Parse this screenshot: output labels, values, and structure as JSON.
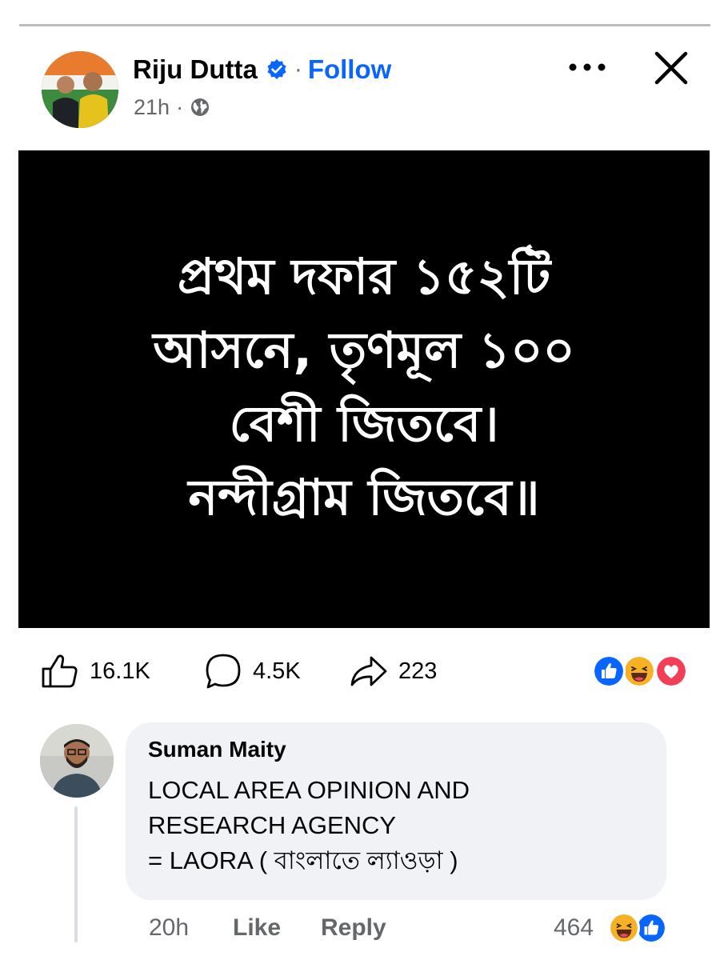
{
  "post": {
    "author": "Riju Dutta",
    "follow_label": "Follow",
    "time": "21h",
    "image_lines": [
      "প্রথম দফার ১৫২টি",
      "আসনে, তৃণমূল ১০০",
      "বেশী জিতবে।",
      "নন্দীগ্রাম জিতবে॥"
    ]
  },
  "actions": {
    "likes": "16.1K",
    "comments": "4.5K",
    "shares": "223"
  },
  "reactions": [
    "like-icon",
    "haha-icon",
    "love-icon"
  ],
  "comment": {
    "author": "Suman Maity",
    "lines": [
      "LOCAL AREA OPINION AND",
      "RESEARCH AGENCY",
      "= LAORA ( বাংলাতে ল্যাওড়া )"
    ],
    "time": "20h",
    "like_label": "Like",
    "reply_label": "Reply",
    "reaction_count": "464",
    "reactions": [
      "haha-icon",
      "like-icon"
    ]
  },
  "colors": {
    "accent_blue": "#0866ff",
    "secondary_text": "#65676b",
    "bubble_bg": "#f0f2f5",
    "love_red": "#f33e58",
    "haha_yellow": "#f7b125"
  }
}
